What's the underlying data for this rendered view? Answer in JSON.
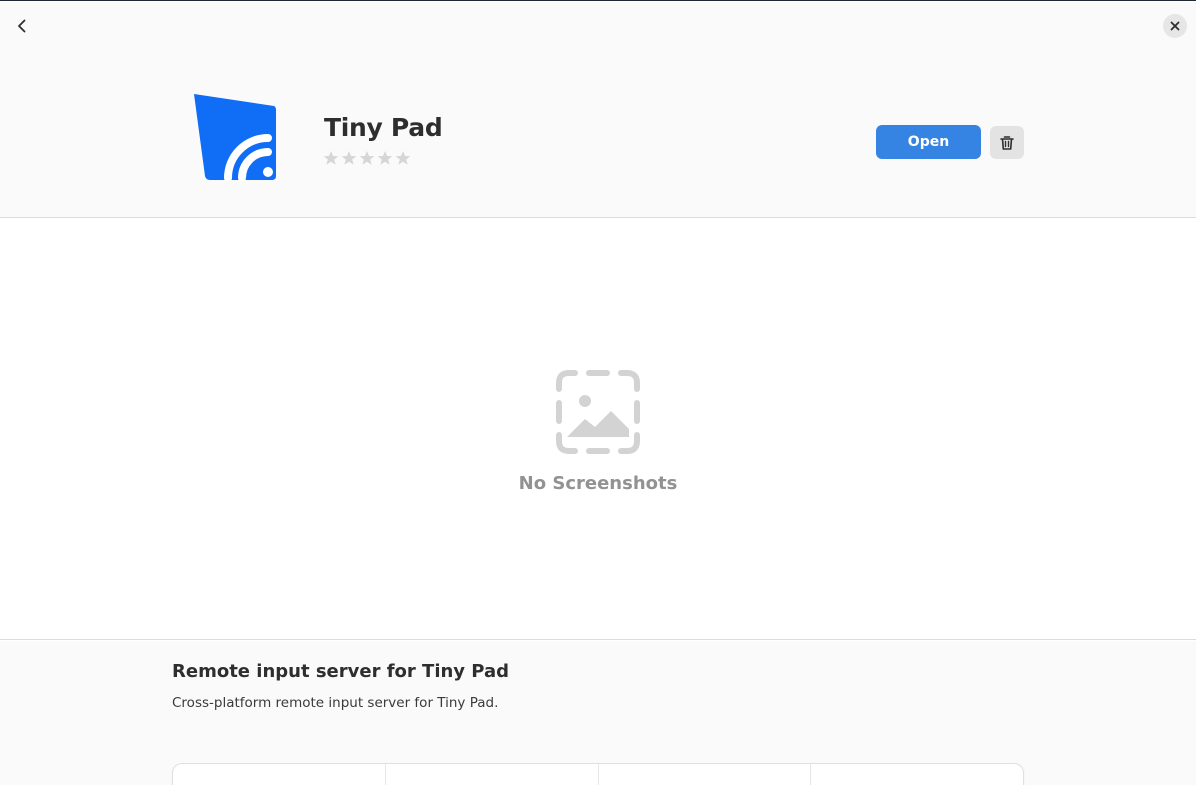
{
  "app": {
    "name": "Tiny Pad",
    "rating": 0,
    "rating_max": 5
  },
  "actions": {
    "open_label": "Open"
  },
  "screenshots": {
    "empty_label": "No Screenshots"
  },
  "description": {
    "title": "Remote input server for Tiny Pad",
    "body": "Cross-platform remote input server for Tiny Pad."
  },
  "colors": {
    "accent": "#3584e4",
    "icon_blue": "#0f6ef5",
    "star_empty": "#d6d6d6",
    "placeholder": "#d3d3d3"
  },
  "icons": {
    "back": "chevron-left-icon",
    "close": "close-icon",
    "delete": "trash-icon",
    "no_screenshots": "image-missing-icon"
  }
}
